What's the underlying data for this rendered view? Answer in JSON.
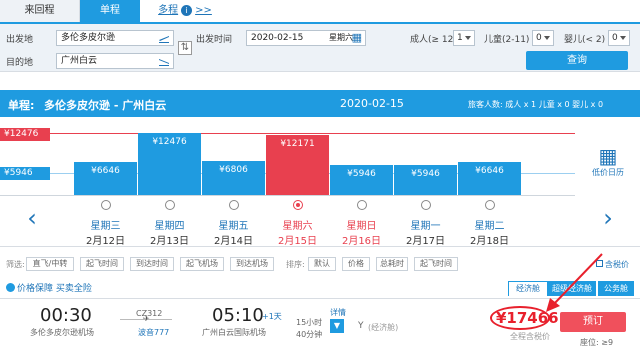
{
  "tabs": {
    "round_trip": "来回程",
    "one_way": "单程",
    "multi": "多程",
    "multi_suffix": ">>",
    "info_icon": "i"
  },
  "search": {
    "from_label": "出发地",
    "from_value": "多伦多皮尔逊",
    "to_label": "目的地",
    "to_value": "广州白云",
    "date_label": "出发时间",
    "date_value": "2020-02-15",
    "date_weekday": "星期六",
    "adult_label": "成人(≥ 12)",
    "adult_value": "1",
    "child_label": "儿童(2-11)",
    "child_value": "0",
    "infant_label": "婴儿(< 2)",
    "infant_value": "0",
    "search_button": "查询"
  },
  "header": {
    "trip_type": "单程:",
    "route": "多伦多皮尔逊 - 广州白云",
    "date": "2020-02-15",
    "pax": "旅客人数: 成人 x 1  儿童 x 0  婴儿 x 0"
  },
  "calendar": {
    "max_price": "¥12476",
    "min_price": "¥5946",
    "low_price_calendar": "低价日历",
    "days": [
      {
        "weekday": "星期三",
        "date": "2月12日",
        "price": "¥6646",
        "value": 6646,
        "selected": false,
        "weekend": false
      },
      {
        "weekday": "星期四",
        "date": "2月13日",
        "price": "¥12476",
        "value": 12476,
        "selected": false,
        "weekend": false
      },
      {
        "weekday": "星期五",
        "date": "2月14日",
        "price": "¥6806",
        "value": 6806,
        "selected": false,
        "weekend": false
      },
      {
        "weekday": "星期六",
        "date": "2月15日",
        "price": "¥12171",
        "value": 12171,
        "selected": true,
        "weekend": true
      },
      {
        "weekday": "星期日",
        "date": "2月16日",
        "price": "¥5946",
        "value": 5946,
        "selected": false,
        "weekend": true
      },
      {
        "weekday": "星期一",
        "date": "2月17日",
        "price": "¥5946",
        "value": 5946,
        "selected": false,
        "weekend": false
      },
      {
        "weekday": "星期二",
        "date": "2月18日",
        "price": "¥6646",
        "value": 6646,
        "selected": false,
        "weekend": false
      }
    ]
  },
  "filters": {
    "label": "筛选:",
    "items": [
      "直飞/中转",
      "起飞时间",
      "到达时间",
      "起飞机场",
      "到达机场"
    ],
    "sort_label": "排序:",
    "sort_items": [
      "默认",
      "价格",
      "总耗时",
      "起飞时间"
    ],
    "tax_included": "含税价"
  },
  "guarantee": {
    "text1": "价格保障",
    "text2": "买卖全险"
  },
  "cabin_tabs": [
    "经济舱",
    "超级经济舱",
    "公务舱"
  ],
  "flight": {
    "dep_time": "00:30",
    "dep_airport": "多伦多皮尔逊机场",
    "flight_no": "CZ312",
    "airline": "波音777",
    "arr_time": "05:10",
    "arr_day": "+1天",
    "arr_airport": "广州白云国际机场",
    "duration_h": "15小时",
    "duration_m": "40分钟",
    "detail": "详情",
    "class": "Y",
    "class_note": "(经济舱)",
    "price": "¥17466",
    "price_note": "全程含税价",
    "book": "预订",
    "seats": "座位: ≥9"
  },
  "colors": {
    "accent": "#1f9be0",
    "selected": "#e8404f",
    "book": "#f0505c"
  }
}
